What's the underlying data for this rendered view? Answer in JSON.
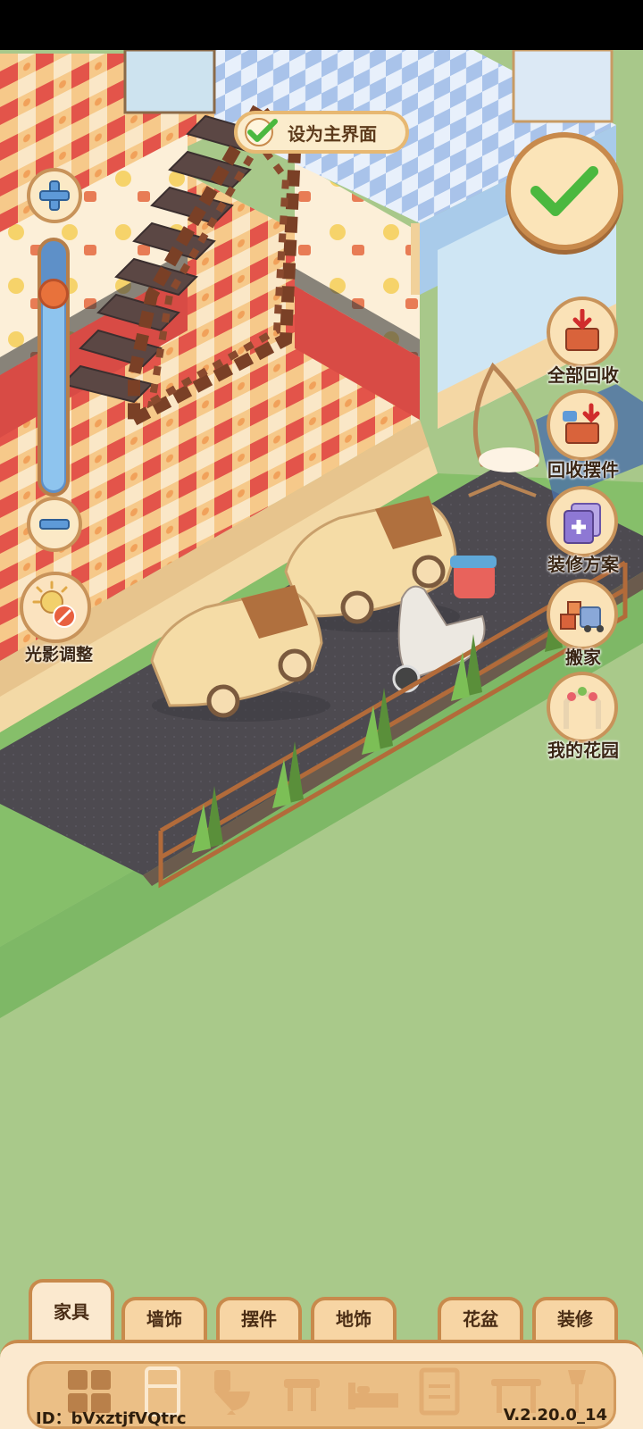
{
  "top_button": {
    "label": "设为主界面"
  },
  "left_panel": {
    "light_label": "光影调整",
    "zoom_level_percent": 78
  },
  "right_menu": [
    {
      "label": "全部回收",
      "icon": "box-recycle-icon"
    },
    {
      "label": "回收摆件",
      "icon": "box-decor-recycle-icon"
    },
    {
      "label": "装修方案",
      "icon": "plan-cards-icon"
    },
    {
      "label": "搬家",
      "icon": "moving-truck-icon"
    },
    {
      "label": "我的花园",
      "icon": "garden-arch-icon"
    }
  ],
  "tabs": [
    {
      "label": "家具",
      "active": true
    },
    {
      "label": "墙饰",
      "active": false
    },
    {
      "label": "摆件",
      "active": false
    },
    {
      "label": "地饰",
      "active": false
    },
    {
      "label": "花盆",
      "active": false
    },
    {
      "label": "装修",
      "active": false
    }
  ],
  "categories": [
    "all-grid-icon",
    "fridge-icon",
    "toilet-icon",
    "stool-icon",
    "bed-icon",
    "cabinet-icon",
    "table-icon",
    "lamp-icon"
  ],
  "footer": {
    "id_text": "ID：bVxztjfVQtrc",
    "version": "V.2.20.0_14"
  },
  "colors": {
    "accent_brown": "#c88a4c",
    "panel_cream": "#fbe9cf",
    "grass": "#a9c98a",
    "check_green": "#4bb83f"
  }
}
